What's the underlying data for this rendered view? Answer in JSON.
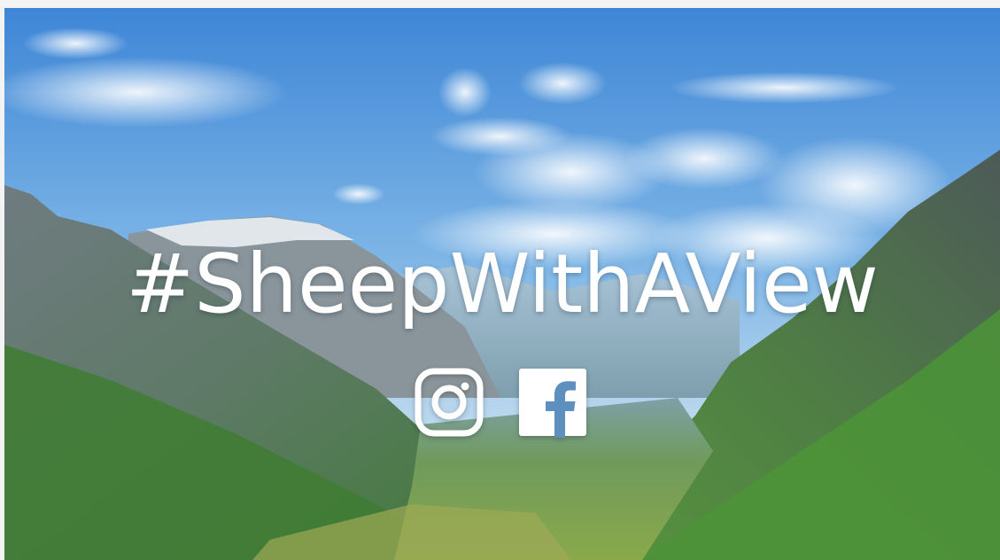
{
  "banner": {
    "hashtag": "#SheepWithAView",
    "social_icons": [
      {
        "name": "instagram-icon"
      },
      {
        "name": "facebook-icon"
      }
    ]
  },
  "colors": {
    "text": "#ffffff",
    "sky": "#5f9ad8",
    "mountain_green": "#4f8a3c"
  }
}
